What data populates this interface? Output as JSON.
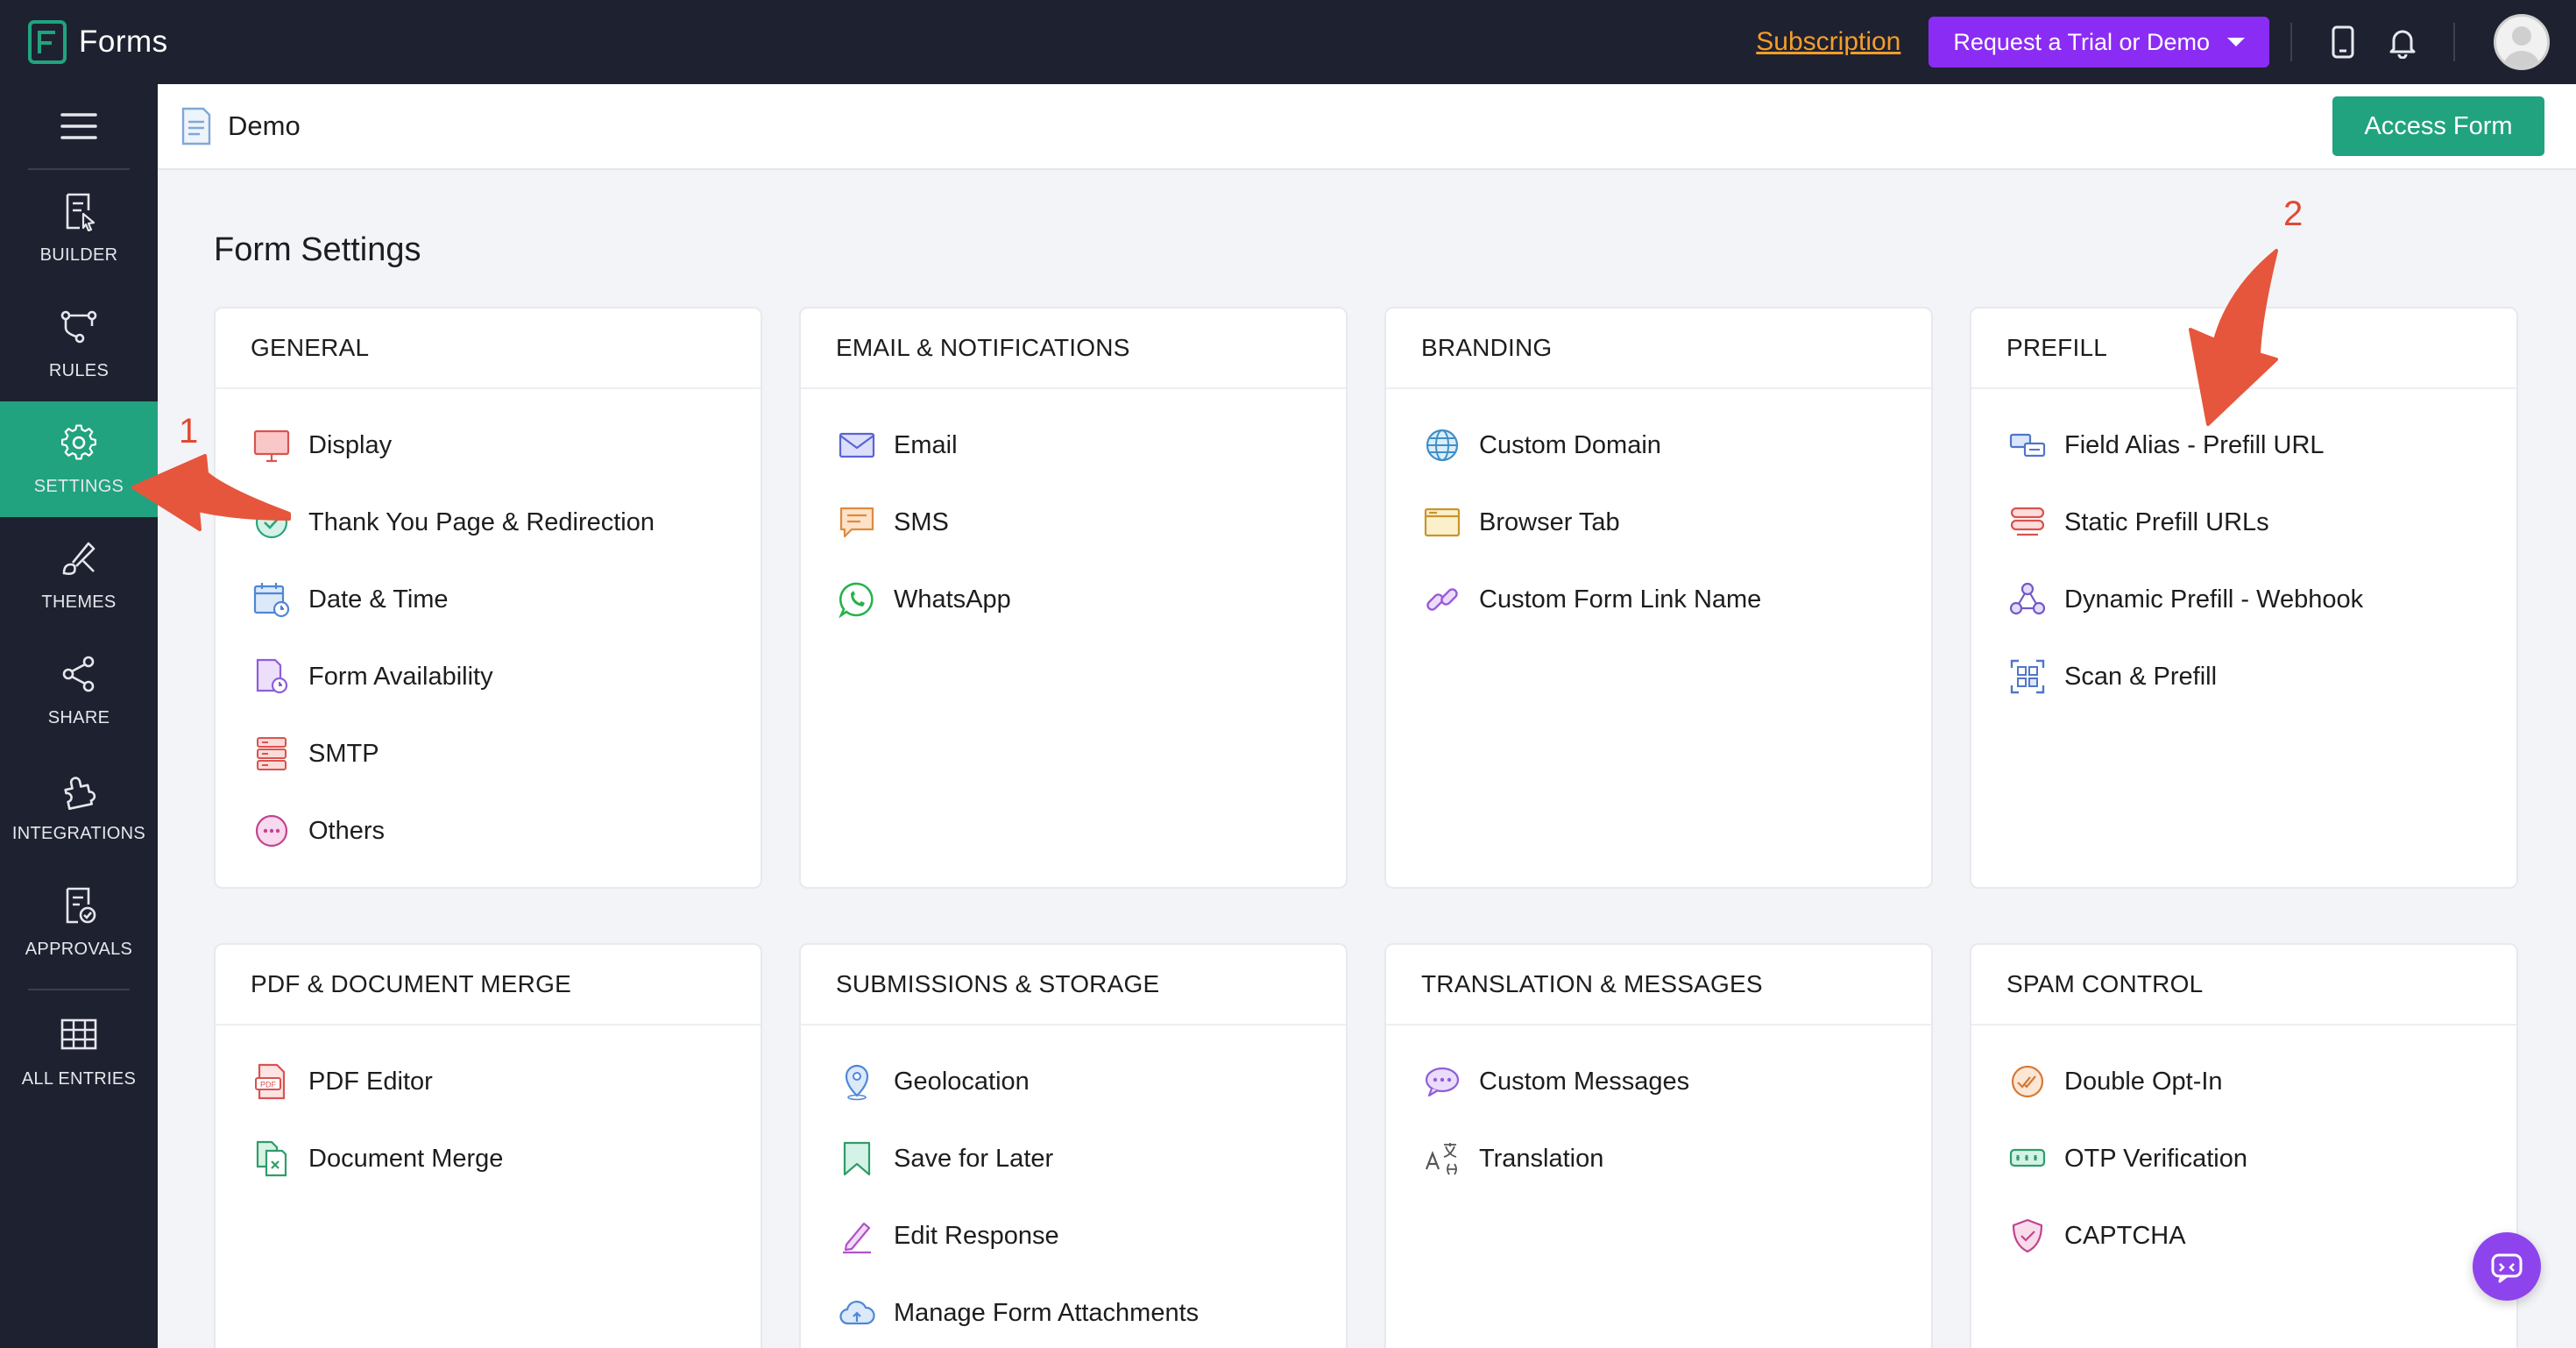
{
  "app": {
    "title": "Forms"
  },
  "topbar": {
    "subscription": "Subscription",
    "trial_button": "Request a Trial or Demo"
  },
  "sidebar": {
    "items": [
      {
        "label": "BUILDER",
        "icon": "builder-icon"
      },
      {
        "label": "RULES",
        "icon": "rules-icon"
      },
      {
        "label": "SETTINGS",
        "icon": "gear-icon",
        "active": true
      },
      {
        "label": "THEMES",
        "icon": "themes-icon"
      },
      {
        "label": "SHARE",
        "icon": "share-icon"
      },
      {
        "label": "INTEGRATIONS",
        "icon": "integrations-icon"
      },
      {
        "label": "APPROVALS",
        "icon": "approvals-icon"
      },
      {
        "label": "ALL ENTRIES",
        "icon": "grid-icon"
      }
    ]
  },
  "header": {
    "form_name": "Demo",
    "access_button": "Access Form"
  },
  "page_title": "Form Settings",
  "cards": [
    {
      "title": "GENERAL",
      "items": [
        {
          "label": "Display",
          "icon": "display-icon"
        },
        {
          "label": "Thank You Page & Redirection",
          "icon": "thank-you-icon"
        },
        {
          "label": "Date & Time",
          "icon": "calendar-clock-icon"
        },
        {
          "label": "Form Availability",
          "icon": "form-availability-icon"
        },
        {
          "label": "SMTP",
          "icon": "smtp-server-icon"
        },
        {
          "label": "Others",
          "icon": "more-icon"
        }
      ]
    },
    {
      "title": "EMAIL & NOTIFICATIONS",
      "items": [
        {
          "label": "Email",
          "icon": "email-icon"
        },
        {
          "label": "SMS",
          "icon": "sms-icon"
        },
        {
          "label": "WhatsApp",
          "icon": "whatsapp-icon"
        }
      ]
    },
    {
      "title": "BRANDING",
      "items": [
        {
          "label": "Custom Domain",
          "icon": "globe-icon"
        },
        {
          "label": "Browser Tab",
          "icon": "browser-tab-icon"
        },
        {
          "label": "Custom Form Link Name",
          "icon": "link-icon"
        }
      ]
    },
    {
      "title": "PREFILL",
      "items": [
        {
          "label": "Field Alias - Prefill URL",
          "icon": "field-alias-icon"
        },
        {
          "label": "Static Prefill URLs",
          "icon": "static-prefill-icon"
        },
        {
          "label": "Dynamic Prefill - Webhook",
          "icon": "webhook-icon"
        },
        {
          "label": "Scan & Prefill",
          "icon": "scan-icon"
        }
      ]
    },
    {
      "title": "PDF & DOCUMENT MERGE",
      "items": [
        {
          "label": "PDF Editor",
          "icon": "pdf-icon"
        },
        {
          "label": "Document Merge",
          "icon": "document-merge-icon"
        }
      ]
    },
    {
      "title": "SUBMISSIONS & STORAGE",
      "items": [
        {
          "label": "Geolocation",
          "icon": "location-pin-icon"
        },
        {
          "label": "Save for Later",
          "icon": "bookmark-icon"
        },
        {
          "label": "Edit Response",
          "icon": "pencil-icon"
        },
        {
          "label": "Manage Form Attachments",
          "icon": "cloud-upload-icon"
        }
      ]
    },
    {
      "title": "TRANSLATION & MESSAGES",
      "items": [
        {
          "label": "Custom Messages",
          "icon": "message-bubble-icon"
        },
        {
          "label": "Translation",
          "icon": "translation-icon"
        }
      ]
    },
    {
      "title": "SPAM CONTROL",
      "items": [
        {
          "label": "Double Opt-In",
          "icon": "double-check-icon"
        },
        {
          "label": "OTP Verification",
          "icon": "otp-icon"
        },
        {
          "label": "CAPTCHA",
          "icon": "captcha-shield-icon"
        }
      ]
    }
  ],
  "annotations": [
    {
      "label": "1"
    },
    {
      "label": "2"
    }
  ],
  "colors": {
    "topbar": "#1e2130",
    "accent_green": "#21a37f",
    "trial_purple": "#8b2cf5",
    "subscription_orange": "#f59d2a",
    "annotation_red": "#e04a32"
  }
}
